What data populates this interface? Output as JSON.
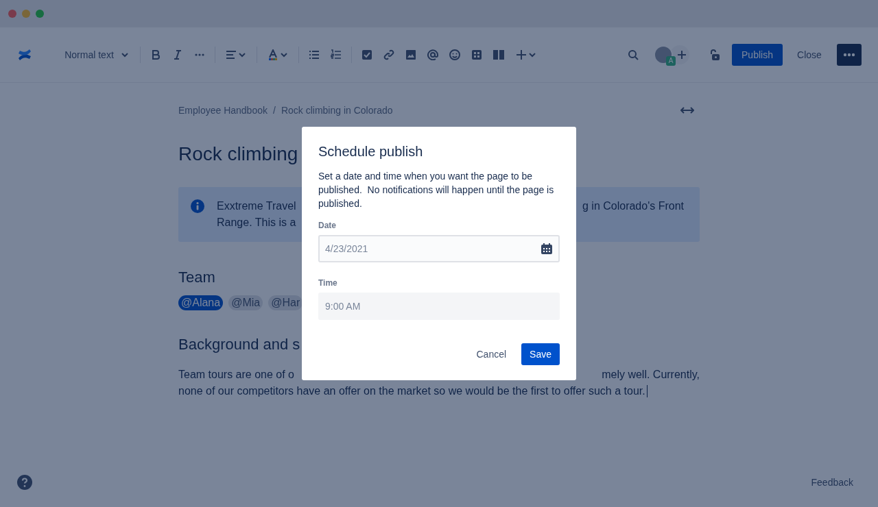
{
  "toolbar": {
    "text_style": "Normal text",
    "collaborator_badge": "A",
    "publish": "Publish",
    "close": "Close"
  },
  "breadcrumbs": {
    "items": [
      "Employee Handbook",
      "Rock climbing in Colorado"
    ],
    "separator": "/"
  },
  "page": {
    "title": "Rock climbing",
    "info_panel": {
      "lines": [
        {
          "left": "Exxtreme Travel",
          "right": "g in Colorado's Front"
        },
        {
          "left": "Range. This is a"
        }
      ]
    },
    "team_heading": "Team",
    "mentions": [
      {
        "label": "@Alana",
        "selected": true
      },
      {
        "label": "@Mia",
        "selected": false
      },
      {
        "label": "@Har",
        "selected": false
      }
    ],
    "background_heading": "Background and s",
    "paragraph": {
      "lines": [
        {
          "left": "Team tours are one of o",
          "right": "mely well. Currently,"
        },
        {
          "left": "none of our competitors have an offer on the market so we would be the first to offer such a tour."
        }
      ],
      "cursor": true
    }
  },
  "dialog": {
    "title": "Schedule publish",
    "description": "Set a date and time when you want the page to be published.  No notifications will happen until the page is published.",
    "fields": [
      {
        "kind": "date",
        "label": "Date",
        "placeholder": "4/23/2021",
        "focused": true
      },
      {
        "kind": "time",
        "label": "Time",
        "placeholder": "9:00 AM",
        "focused": false
      }
    ],
    "buttons": [
      {
        "kind": "subtle",
        "label": "Cancel"
      },
      {
        "kind": "primary",
        "label": "Save"
      }
    ]
  },
  "footer": {
    "feedback": "Feedback"
  }
}
